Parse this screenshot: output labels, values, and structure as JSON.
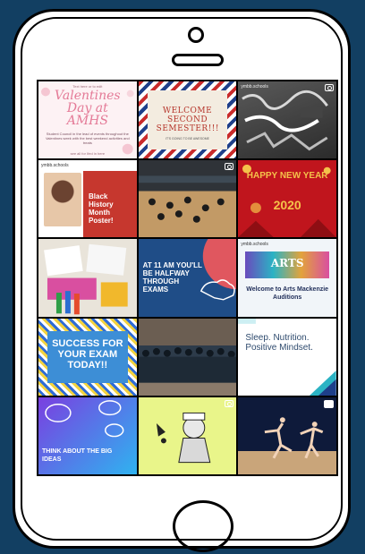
{
  "tiles": {
    "t1": {
      "top": "Text here or to edit",
      "title": "Valentines Day at AMHS",
      "body": "Student Council in the lead of events throughout the Valentines week with the best weekend activities and treats",
      "foot": "see all for Ifed in here"
    },
    "t2": {
      "title": "WELCOME SECOND SEMESTER!!!",
      "sub": "IT'S GOING TO BE AWESOME"
    },
    "t3": {
      "account": "ymbb.schools"
    },
    "t4": {
      "account": "ymbb.schools",
      "title": "Black History Month Poster!"
    },
    "t6": {
      "title": "HAPPY NEW YEAR",
      "year": "2020"
    },
    "t8": {
      "title": "AT 11 AM YOU'LL BE HALFWAY THROUGH EXAMS"
    },
    "t9": {
      "account": "ymbb.schools",
      "banner": "ARTS",
      "title": "Welcome to Arts Mackenzie Auditions"
    },
    "t10": {
      "title": "SUCCESS FOR YOUR EXAM TODAY!!"
    },
    "t12": {
      "title": "Sleep. Nutrition. Positive Mindset."
    },
    "t13": {
      "title": "THINK ABOUT THE BIG IDEAS"
    }
  },
  "colors": {
    "background": "#123f62",
    "phone_body": "#ffffff",
    "valentine_pink": "#e47a97",
    "newyear_red": "#c0151d",
    "gold": "#f4c24a",
    "exam_blue": "#1f4d87",
    "arts_purple": "#6a4bbd",
    "teal": "#2bb3c4"
  }
}
